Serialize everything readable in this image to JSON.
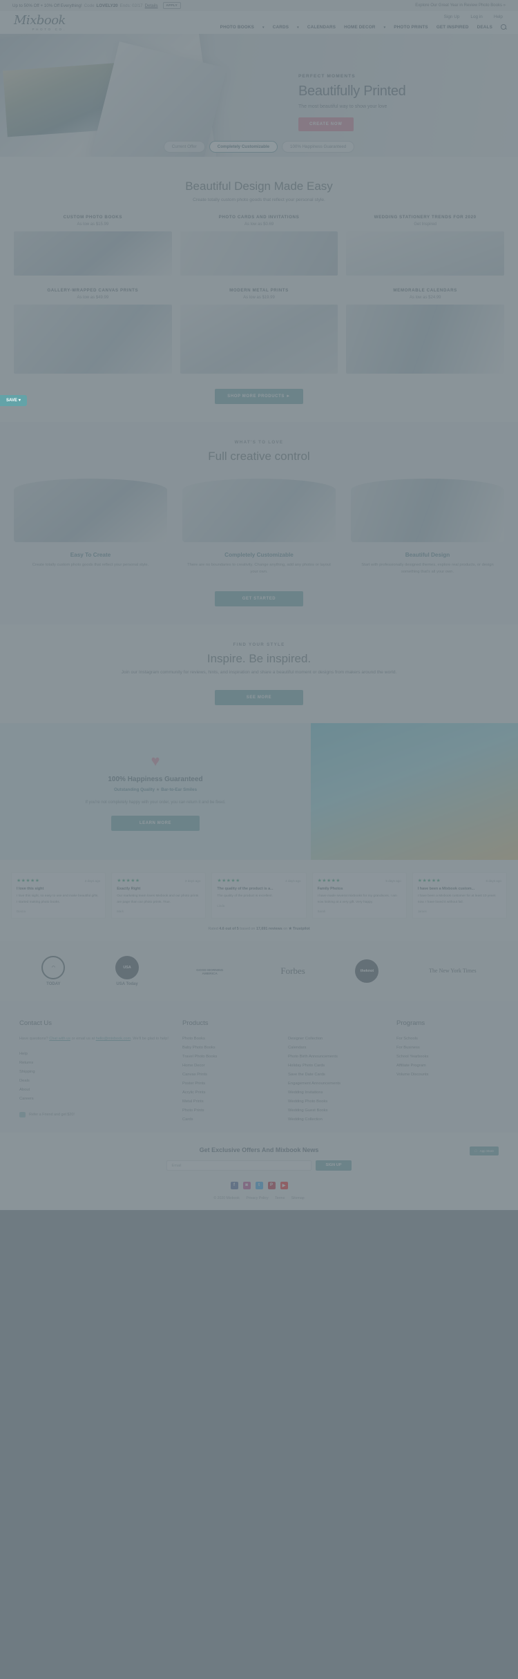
{
  "promo": {
    "text_a": "Up to 50% Off + 10% Off Everything!",
    "code_label": "Code",
    "code": "LOVELY20",
    "ends": "Ends: 02/17",
    "details": "Details",
    "apply": "APPLY",
    "right": "Explore Our Great Year in Review Photo Books »"
  },
  "header": {
    "logo_script": "Mixbook",
    "logo_sub": "PHOTO CO.",
    "utility": [
      "Sign Up",
      "Log in",
      "Help"
    ],
    "nav": [
      {
        "label": "PHOTO BOOKS",
        "caret": true
      },
      {
        "label": "CARDS",
        "caret": true
      },
      {
        "label": "CALENDARS",
        "caret": false
      },
      {
        "label": "HOME DECOR",
        "caret": true
      },
      {
        "label": "PHOTO PRINTS",
        "caret": false
      },
      {
        "label": "GET INSPIRED",
        "caret": false
      },
      {
        "label": "DEALS",
        "caret": false
      }
    ],
    "search_icon": "search-icon"
  },
  "hero": {
    "eyebrow": "PERFECT MOMENTS",
    "title": "Beautifully Printed",
    "subtitle": "The most beautiful way to show your love",
    "cta": "CREATE NOW",
    "tabs": [
      {
        "label": "Current Offer",
        "active": false
      },
      {
        "label": "Completely Customizable",
        "active": true
      },
      {
        "label": "100% Happiness Guaranteed",
        "active": false
      }
    ]
  },
  "save_tab": "SAVE ♥",
  "products": {
    "eyebrow": "",
    "title": "Beautiful Design Made Easy",
    "subtitle": "Create totally custom photo goods that reflect your personal style.",
    "cards": [
      {
        "title": "CUSTOM PHOTO BOOKS",
        "price": "As low as $15.99",
        "img": "img-a"
      },
      {
        "title": "PHOTO CARDS AND INVITATIONS",
        "price": "As low as $0.69",
        "img": "img-b"
      },
      {
        "title": "WEDDING STATIONERY TRENDS FOR 2020",
        "price": "Get Inspired",
        "img": "img-c"
      },
      {
        "title": "GALLERY-WRAPPED CANVAS PRINTS",
        "price": "As low as $49.99",
        "img": "img-d"
      },
      {
        "title": "MODERN METAL PRINTS",
        "price": "As low as $19.99",
        "img": "img-e"
      },
      {
        "title": "MEMORABLE CALENDARS",
        "price": "As low as $24.99",
        "img": "img-f"
      }
    ],
    "cta": "SHOP MORE PRODUCTS ►"
  },
  "creative": {
    "eyebrow": "WHAT'S TO LOVE",
    "title": "Full creative control",
    "features": [
      {
        "title": "Easy To Create",
        "body": "Create totally custom photo goods that reflect your personal style."
      },
      {
        "title": "Completely Customizable",
        "body": "There are no boundaries to creativity. Change anything, add any photos or layout your own."
      },
      {
        "title": "Beautiful Design",
        "body": "Start with professionally designed themes, explore real products, or design something that's all your own."
      }
    ],
    "cta": "GET STARTED"
  },
  "inspire": {
    "eyebrow": "FIND YOUR STYLE",
    "title": "Inspire. Be inspired.",
    "subtitle": "Join our Instagram community for reviews, hints, and inspiration and share a beautiful moment or designs from makers around the world.",
    "cta": "SEE MORE"
  },
  "guarantee": {
    "heart_icon": "heart-icon",
    "title": "100% Happiness Guaranteed",
    "quality": "Outstanding Quality",
    "separator": "★",
    "service": "Bar-to-Ear Smiles",
    "body": "If you're not completely happy with your order, you can return it and be fixed.",
    "cta": "LEARN MORE"
  },
  "reviews": {
    "items": [
      {
        "stars": "★★★★★",
        "date": "2 days ago",
        "title": "I love this sight",
        "body": "I love this sight, so easy to use and make beautiful gifts. I started making photo books.",
        "author": "Donna"
      },
      {
        "stars": "★★★★★",
        "date": "3 days ago",
        "title": "Exactly Right",
        "body": "Our marketing team loves Mixbook and our photo prints are page than our photo prints. True.",
        "author": "Mark"
      },
      {
        "stars": "★★★★★",
        "date": "4 days ago",
        "title": "The quality of the product is a...",
        "body": "The quality of the product is excellent.",
        "author": "Linda"
      },
      {
        "stars": "★★★★★",
        "date": "5 days ago",
        "title": "Family Photos",
        "body": "I have made several mixbooks for my grandsons. I am now looking at a very gift. Very happy.",
        "author": "Sarah"
      },
      {
        "stars": "★★★★★",
        "date": "6 days ago",
        "title": "I have been a Mixbook custom...",
        "body": "I have been a Mixbook customer for at least 10 years now. I have loved it without fail.",
        "author": "James"
      }
    ],
    "trust_prefix": "Rated",
    "trust_score": "4.6 out of 5",
    "trust_mid": "based on",
    "trust_count": "17,691 reviews",
    "trust_suffix": "on",
    "trust_brand": "★ Trustpilot"
  },
  "press": [
    {
      "kind": "word",
      "label": "TODAY",
      "icon": "today-logo"
    },
    {
      "kind": "circle",
      "label": "USA Today",
      "icon": "usa-today-logo"
    },
    {
      "kind": "word",
      "label": "GOOD MORNING AMERICA",
      "icon": "gma-logo"
    },
    {
      "kind": "serif",
      "label": "Forbes",
      "icon": "forbes-logo"
    },
    {
      "kind": "circle",
      "label": "theknot",
      "icon": "knot-logo"
    },
    {
      "kind": "serif",
      "label": "The New York Times",
      "icon": "nyt-logo"
    }
  ],
  "footer": {
    "contact": {
      "heading": "Contact Us",
      "note_a": "Have questions?",
      "note_link": "Chat with us",
      "note_b": "or email us at",
      "email": "hello@mixbook.com",
      "note_c": ". We'll be glad to help!",
      "links": [
        "Help",
        "Returns",
        "Shipping",
        "Deals",
        "About",
        "Careers"
      ],
      "chat": "Refer a Friend and get $20!"
    },
    "products": {
      "heading": "Products",
      "col1": [
        "Photo Books",
        "Baby Photo Books",
        "Travel Photo Books",
        "Home Decor",
        "Canvas Prints",
        "Poster Prints",
        "Acrylic Prints",
        "Metal Prints",
        "Photo Prints",
        "Cards"
      ],
      "col2": [
        "Designer Collection",
        "Calendars",
        "Photo Birth Announcements",
        "Holiday Photo Cards",
        "Save the Date Cards",
        "Engagement Announcements",
        "Wedding Invitations",
        "Wedding Photo Books",
        "Wedding Guest Books",
        "Wedding Collection"
      ]
    },
    "programs": {
      "heading": "Programs",
      "links": [
        "For Schools",
        "For Business",
        "School Yearbooks",
        "Affiliate Program",
        "Volume Discounts"
      ]
    }
  },
  "newsletter": {
    "heading": "Get Exclusive Offers And Mixbook News",
    "placeholder": "Email",
    "button": "SIGN UP",
    "app_badge_line1": "Download on the",
    "app_badge_line2": "App Store",
    "socials": [
      {
        "name": "facebook-icon",
        "glyph": "f",
        "color": "#3b5998"
      },
      {
        "name": "instagram-icon",
        "glyph": "◙",
        "color": "#c13584"
      },
      {
        "name": "twitter-icon",
        "glyph": "t",
        "color": "#1da1f2"
      },
      {
        "name": "pinterest-icon",
        "glyph": "P",
        "color": "#bd081c"
      },
      {
        "name": "youtube-icon",
        "glyph": "▶",
        "color": "#ff0000"
      }
    ],
    "legal": [
      "© 2020 Mixbook",
      "Privacy Policy",
      "Terms",
      "Sitemap"
    ]
  },
  "colors": {
    "teal": "#5f9ea4",
    "pink": "#d4738c",
    "ink": "#4c5e68"
  }
}
